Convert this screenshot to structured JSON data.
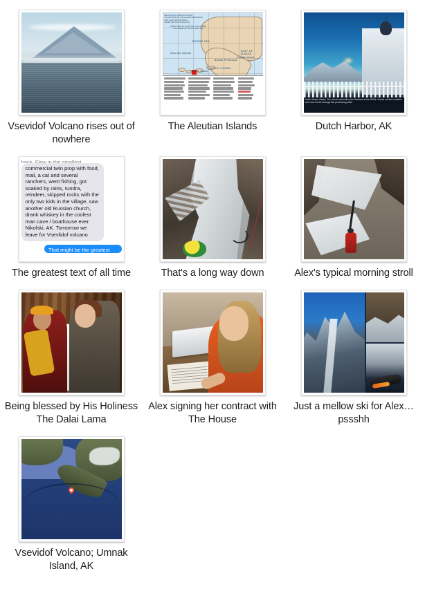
{
  "page": {
    "background_color": "#ffffff",
    "caption_color": "#1d1d1d",
    "layout": "3-column photo gallery grid",
    "item_count": 10
  },
  "gallery": {
    "items": [
      {
        "id": "vsevidof-volcano",
        "caption": "Vsevidof Volcano rises out of nowhere",
        "image_kind": "photo-volcano-sea"
      },
      {
        "id": "aleutian-islands",
        "caption": "The Aleutian Islands",
        "image_kind": "map-usgs-aleutians",
        "map_text": {
          "line1": "GEOLOGICAL SURVEY DDS-40",
          "line2": "VOLCANOES OF THE ALASKA PENINSULA",
          "line3": "AND ALEUTIAN ISLANDS—",
          "line4": "SELECTED PHOTOGRAPHS",
          "index_title": "INDEX MAP OF ALEUTIAN VOLCANOES INCLUDED IN THIS COLLECTION",
          "sea_label": "BERING SEA",
          "ocean_label": "PACIFIC OCEAN",
          "islands_label": "Aleutian Islands",
          "peninsula_label": "Alaska Peninsula",
          "gulf_label": "GULF OF ALASKA",
          "kodiak_label": "Kodiak Island",
          "umnak_label": "Umnak Island"
        }
      },
      {
        "id": "dutch-harbor",
        "caption": "Dutch Harbor, AK",
        "image_kind": "photo-church-dusk",
        "overlay_caption": "Dutch Harbor, Alaska. The church was built by the Russians in the 1800s. It looks out like a weather worn sore thumb amongst fish processing plants."
      },
      {
        "id": "greatest-text",
        "caption": "The greatest text of all time",
        "image_kind": "screenshot-imessage",
        "message_in_clipped": "back. Flew in the smallest",
        "message_in": "commercial twin prop with food, mail, a cat and several ranchers,  went fishing, got soaked by rains, tundra, reindeer, skipped rocks with the only two kids in the village, saw another old Russian church, drank whiskey in the coolest man cave / boathouse ever. Nikolski, AK. Tomorrow we leave for Vsevlidof volcano",
        "message_out": "That might be the greatest",
        "bubble_in_color": "#e6e5eb",
        "bubble_out_color": "#1b8dfb"
      },
      {
        "id": "long-way-down",
        "caption": "That's a long way down",
        "image_kind": "photo-couloir"
      },
      {
        "id": "morning-stroll",
        "caption": "Alex's typical morning stroll",
        "image_kind": "photo-ski-mountaineer"
      },
      {
        "id": "dalai-lama",
        "caption": "Being blessed by His Holiness The Dalai Lama",
        "image_kind": "photo-blessing"
      },
      {
        "id": "signing-contract",
        "caption": "Alex signing her contract with The House",
        "image_kind": "photo-signing"
      },
      {
        "id": "mellow-ski",
        "caption": "Just a mellow ski for Alex… pssshh",
        "image_kind": "photo-collage-ski"
      },
      {
        "id": "vsevidof-map",
        "caption": "Vsevidof Volcano; Umnak Island, AK",
        "image_kind": "map-satellite-alaska",
        "pin_color": "#ef4b31"
      }
    ]
  }
}
